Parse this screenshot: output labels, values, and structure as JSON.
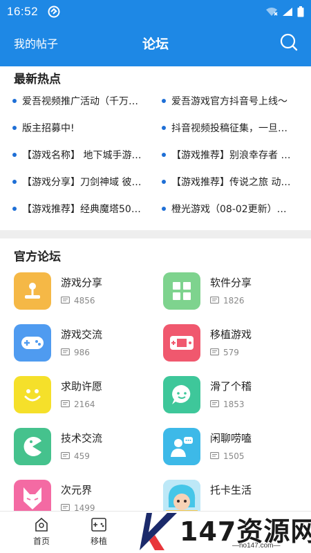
{
  "status": {
    "time": "16:52"
  },
  "header": {
    "left_label": "我的帖子",
    "title": "论坛"
  },
  "hot": {
    "title": "最新热点",
    "items": [
      "爱吾视频推广活动（千万…",
      "爱吾游戏官方抖音号上线～",
      "版主招募中!",
      "抖音视频投稿征集，一旦…",
      "【游戏名称】 地下城手游…",
      "【游戏推荐】别浪幸存者 …",
      "【游戏分享】刀剑神域 彼…",
      "【游戏推荐】传说之旅 动…",
      "【游戏推荐】经典魔塔50…",
      "橙光游戏（08-02更新）…"
    ]
  },
  "forums": {
    "title": "官方论坛",
    "items": [
      {
        "name": "游戏分享",
        "count": "4856",
        "icon": "joystick-icon",
        "color": "#f5b846"
      },
      {
        "name": "软件分享",
        "count": "1826",
        "icon": "apps-grid-icon",
        "color": "#7ed38e"
      },
      {
        "name": "游戏交流",
        "count": "986",
        "icon": "gamepad-icon",
        "color": "#4f9bf0"
      },
      {
        "name": "移植游戏",
        "count": "579",
        "icon": "handheld-console-icon",
        "color": "#f0586e"
      },
      {
        "name": "求助许愿",
        "count": "2164",
        "icon": "smiley-icon",
        "color": "#f5e02a"
      },
      {
        "name": "滑了个稽",
        "count": "1853",
        "icon": "chat-bubble-icon",
        "color": "#3ec79a"
      },
      {
        "name": "技术交流",
        "count": "459",
        "icon": "pacman-icon",
        "color": "#45c28d"
      },
      {
        "name": "闲聊唠嗑",
        "count": "1505",
        "icon": "user-chat-icon",
        "color": "#3db9e8"
      },
      {
        "name": "次元界",
        "count": "1499",
        "icon": "fox-mask-icon",
        "color": "#f46aa3"
      },
      {
        "name": "托卡生活",
        "count": "",
        "icon": "toca-character-image",
        "color": "#8fd4f5"
      }
    ]
  },
  "nav": {
    "items": [
      {
        "label": "首页",
        "icon": "home-icon"
      },
      {
        "label": "移植",
        "icon": "handheld-game-icon"
      }
    ]
  },
  "watermark": {
    "text": "147资源网",
    "url": "—no147.com—"
  },
  "colors": {
    "primary": "#1e88e5",
    "dot": "#1e6fd6"
  }
}
